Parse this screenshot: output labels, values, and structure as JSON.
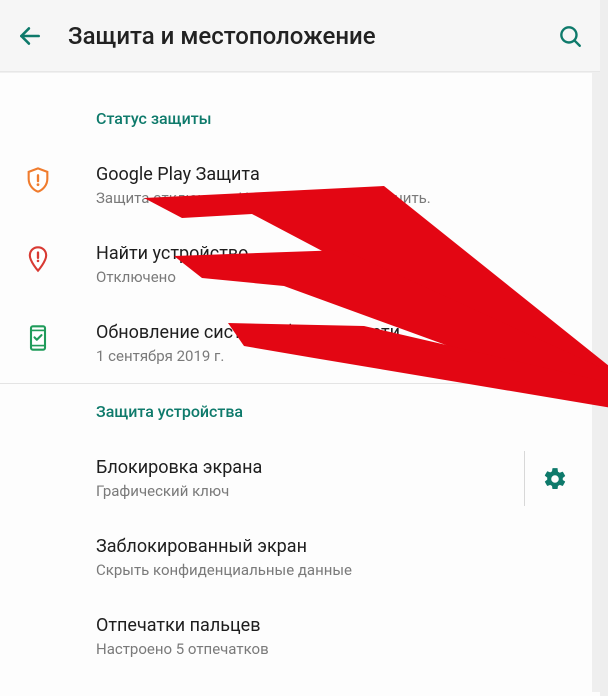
{
  "appbar": {
    "title": "Защита и местоположение"
  },
  "sections": {
    "status": {
      "header": "Статус защиты",
      "items": [
        {
          "title": "Google Play Защита",
          "sub": "Защита отключена. Нажмите, чтобы включить."
        },
        {
          "title": "Найти устройство",
          "sub": "Отключено"
        },
        {
          "title": "Обновление системы безопасности",
          "sub": "1 сентября 2019 г."
        }
      ]
    },
    "device": {
      "header": "Защита устройства",
      "items": [
        {
          "title": "Блокировка экрана",
          "sub": "Графический ключ"
        },
        {
          "title": "Заблокированный экран",
          "sub": "Скрыть конфиденциальные данные"
        },
        {
          "title": "Отпечатки пальцев",
          "sub": "Настроено 5 отпечатков"
        }
      ]
    }
  }
}
